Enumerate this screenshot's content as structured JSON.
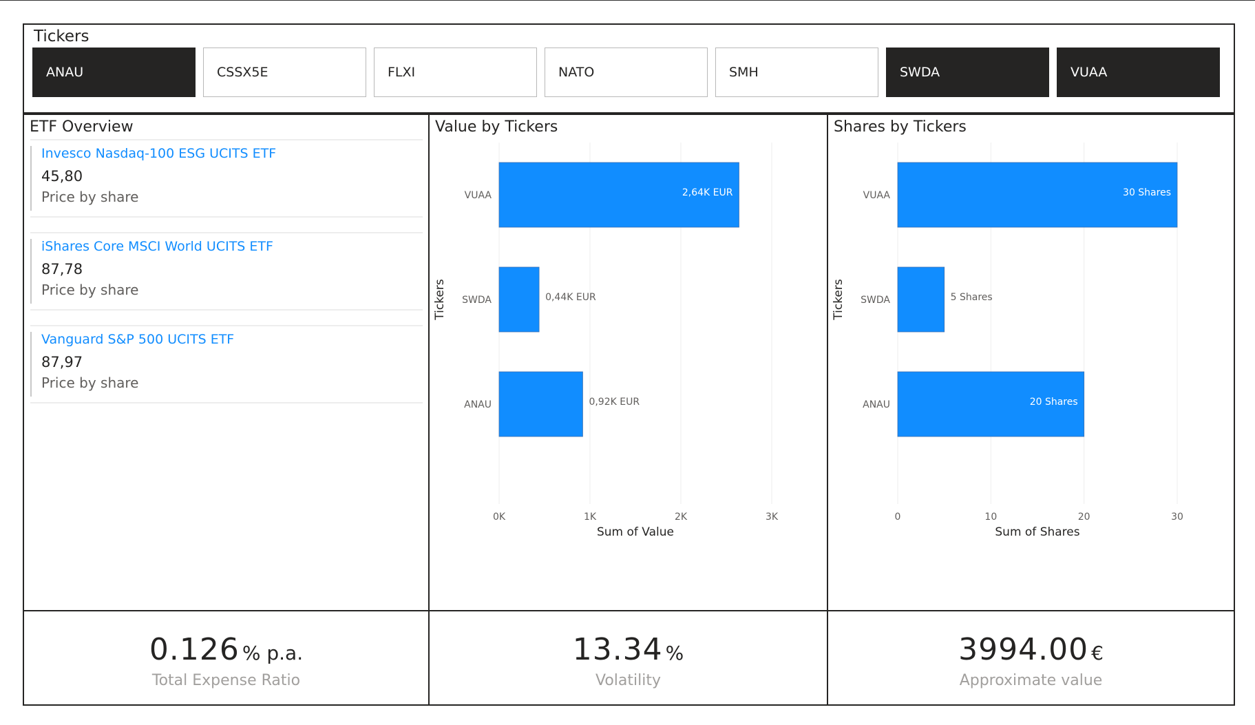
{
  "tickers": {
    "title": "Tickers",
    "buttons": [
      {
        "label": "ANAU",
        "selected": true
      },
      {
        "label": "CSSX5E",
        "selected": false
      },
      {
        "label": "FLXI",
        "selected": false
      },
      {
        "label": "NATO",
        "selected": false
      },
      {
        "label": "SMH",
        "selected": false
      },
      {
        "label": "SWDA",
        "selected": true
      },
      {
        "label": "VUAA",
        "selected": true
      }
    ]
  },
  "overview": {
    "title": "ETF Overview",
    "cards": [
      {
        "name": "Invesco Nasdaq-100 ESG UCITS ETF",
        "price": "45,80",
        "label": "Price by share"
      },
      {
        "name": "iShares Core MSCI World UCITS ETF",
        "price": "87,78",
        "label": "Price by share"
      },
      {
        "name": "Vanguard S&P 500 UCITS ETF",
        "price": "87,97",
        "label": "Price by share"
      }
    ]
  },
  "value_chart": {
    "title": "Value by Tickers"
  },
  "shares_chart": {
    "title": "Shares by Tickers"
  },
  "chart_data": [
    {
      "type": "bar",
      "orientation": "horizontal",
      "title": "Value by Tickers",
      "xlabel": "Sum of Value",
      "ylabel": "Tickers",
      "categories": [
        "VUAA",
        "SWDA",
        "ANAU"
      ],
      "values": [
        2640,
        440,
        920
      ],
      "data_labels": [
        "2,64K EUR",
        "0,44K EUR",
        "0,92K EUR"
      ],
      "xlim": [
        0,
        3000
      ],
      "xticks": [
        {
          "v": 0,
          "label": "0K"
        },
        {
          "v": 1000,
          "label": "1K"
        },
        {
          "v": 2000,
          "label": "2K"
        },
        {
          "v": 3000,
          "label": "3K"
        }
      ],
      "grid": true,
      "color": "#118dff"
    },
    {
      "type": "bar",
      "orientation": "horizontal",
      "title": "Shares by Tickers",
      "xlabel": "Sum of Shares",
      "ylabel": "Tickers",
      "categories": [
        "VUAA",
        "SWDA",
        "ANAU"
      ],
      "values": [
        30,
        5,
        20
      ],
      "data_labels": [
        "30 Shares",
        "5 Shares",
        "20 Shares"
      ],
      "xlim": [
        0,
        30
      ],
      "xticks": [
        {
          "v": 0,
          "label": "0"
        },
        {
          "v": 10,
          "label": "10"
        },
        {
          "v": 20,
          "label": "20"
        },
        {
          "v": 30,
          "label": "30"
        }
      ],
      "grid": true,
      "color": "#118dff"
    }
  ],
  "kpis": {
    "ter": {
      "value": "0.126",
      "unit": "% p.a.",
      "label": "Total Expense Ratio"
    },
    "volatility": {
      "value": "13.34",
      "unit": "%",
      "label": "Volatility"
    },
    "approx": {
      "value": "3994.00",
      "unit": "€",
      "label": "Approximate value"
    }
  }
}
